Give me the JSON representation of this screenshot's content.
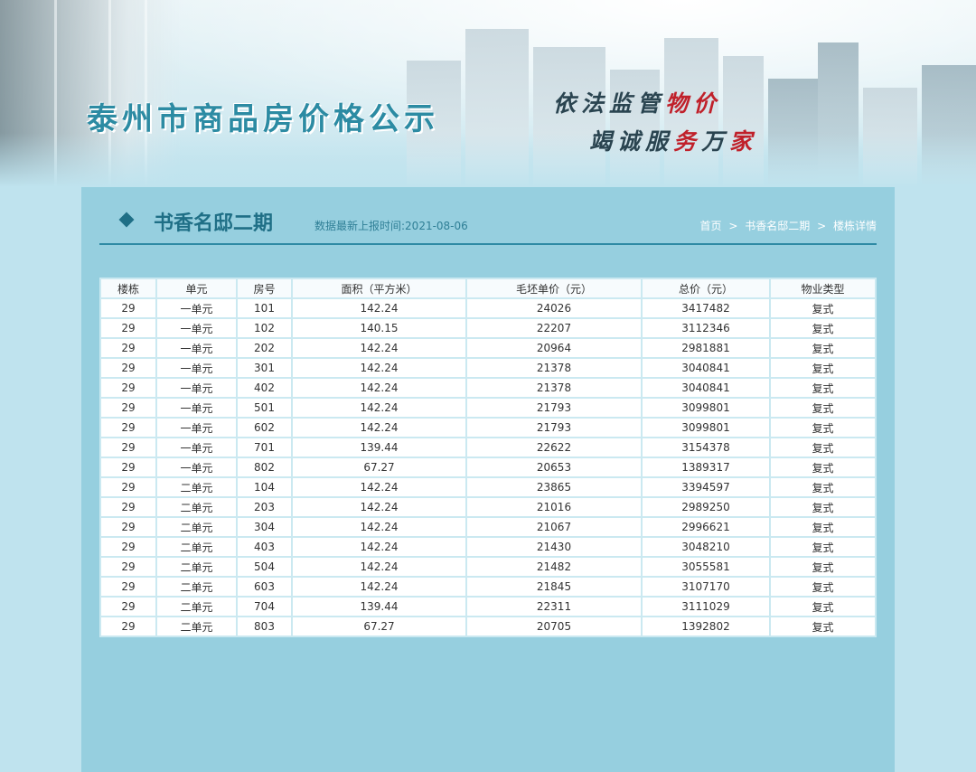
{
  "header": {
    "site_title": "泰州市商品房价格公示",
    "slogan_line1": [
      "依",
      "法",
      "监",
      "管",
      "物",
      "价"
    ],
    "slogan_line2": [
      "竭",
      "诚",
      "服",
      "务",
      "万",
      "家"
    ]
  },
  "project": {
    "name": "书香名邸二期",
    "report_time": "数据最新上报时间:2021-08-06"
  },
  "breadcrumb": {
    "home": "首页",
    "project": "书香名邸二期",
    "current": "楼栋详情",
    "separator": ">"
  },
  "table": {
    "columns": [
      "楼栋",
      "单元",
      "房号",
      "面积（平方米）",
      "毛坯单价（元）",
      "总价（元）",
      "物业类型"
    ],
    "rows": [
      [
        "29",
        "一单元",
        "101",
        "142.24",
        "24026",
        "3417482",
        "复式"
      ],
      [
        "29",
        "一单元",
        "102",
        "140.15",
        "22207",
        "3112346",
        "复式"
      ],
      [
        "29",
        "一单元",
        "202",
        "142.24",
        "20964",
        "2981881",
        "复式"
      ],
      [
        "29",
        "一单元",
        "301",
        "142.24",
        "21378",
        "3040841",
        "复式"
      ],
      [
        "29",
        "一单元",
        "402",
        "142.24",
        "21378",
        "3040841",
        "复式"
      ],
      [
        "29",
        "一单元",
        "501",
        "142.24",
        "21793",
        "3099801",
        "复式"
      ],
      [
        "29",
        "一单元",
        "602",
        "142.24",
        "21793",
        "3099801",
        "复式"
      ],
      [
        "29",
        "一单元",
        "701",
        "139.44",
        "22622",
        "3154378",
        "复式"
      ],
      [
        "29",
        "一单元",
        "802",
        "67.27",
        "20653",
        "1389317",
        "复式"
      ],
      [
        "29",
        "二单元",
        "104",
        "142.24",
        "23865",
        "3394597",
        "复式"
      ],
      [
        "29",
        "二单元",
        "203",
        "142.24",
        "21016",
        "2989250",
        "复式"
      ],
      [
        "29",
        "二单元",
        "304",
        "142.24",
        "21067",
        "2996621",
        "复式"
      ],
      [
        "29",
        "二单元",
        "403",
        "142.24",
        "21430",
        "3048210",
        "复式"
      ],
      [
        "29",
        "二单元",
        "504",
        "142.24",
        "21482",
        "3055581",
        "复式"
      ],
      [
        "29",
        "二单元",
        "603",
        "142.24",
        "21845",
        "3107170",
        "复式"
      ],
      [
        "29",
        "二单元",
        "704",
        "139.44",
        "22311",
        "3111029",
        "复式"
      ],
      [
        "29",
        "二单元",
        "803",
        "67.27",
        "20705",
        "1392802",
        "复式"
      ]
    ]
  },
  "colors": {
    "accent": "#2e8aa4",
    "panel_bg": "#96cfdf",
    "page_bg": "#bfe3ee",
    "slogan_red": "#c0202a"
  }
}
